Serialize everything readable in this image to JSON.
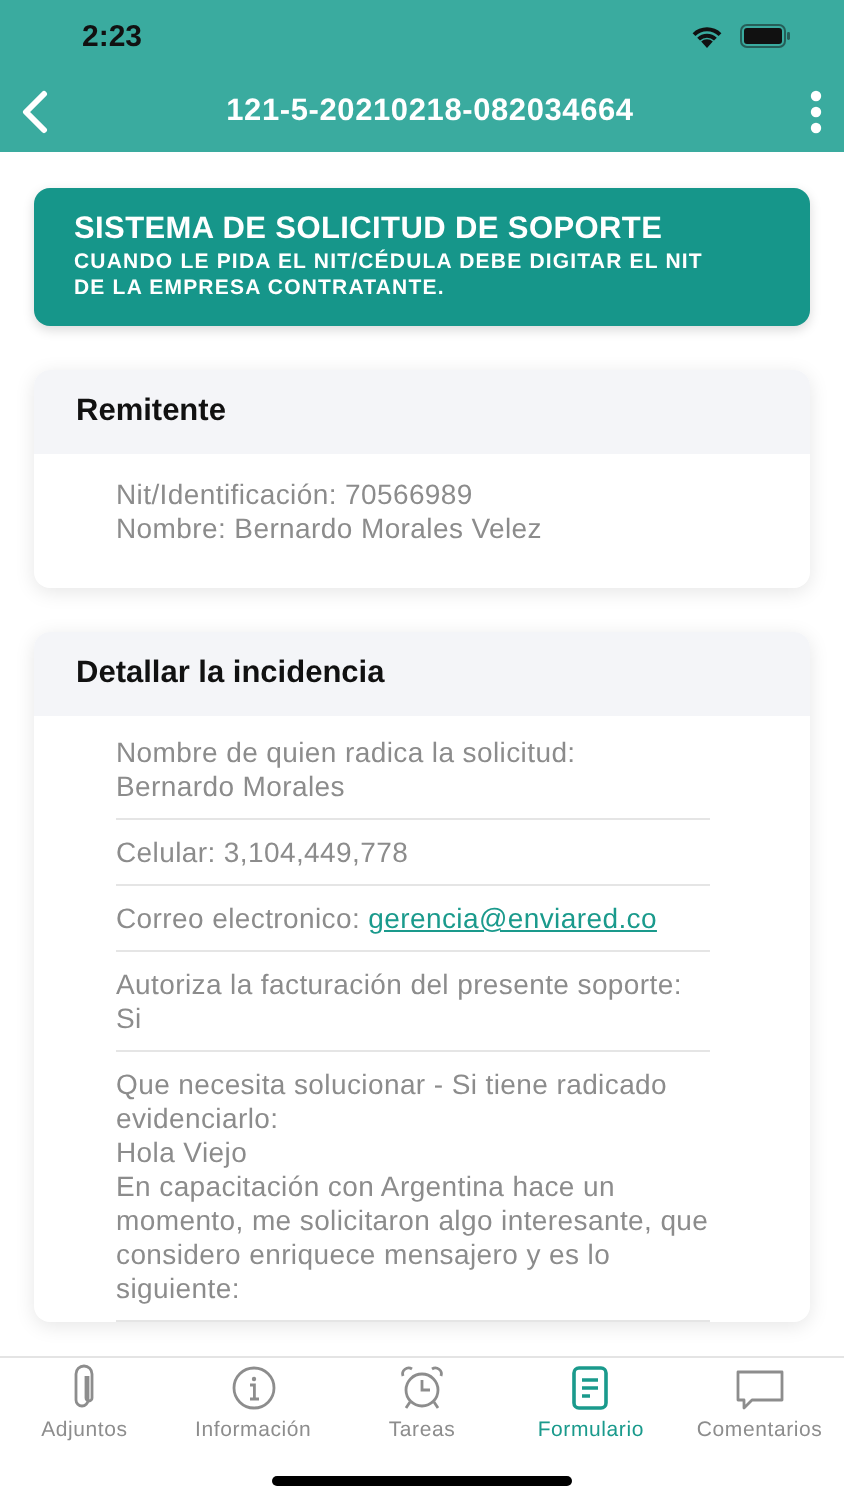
{
  "status_bar": {
    "time": "2:23"
  },
  "header": {
    "title": "121-5-20210218-082034664"
  },
  "banner": {
    "title": "SISTEMA DE SOLICITUD DE SOPORTE",
    "subtitle": "CUANDO LE PIDA EL NIT/CÉDULA DEBE DIGITAR EL NIT DE LA EMPRESA CONTRATANTE."
  },
  "sections": [
    {
      "title": "Remitente",
      "fields": [
        {
          "lines": [
            "Nit/Identificación: 70566989",
            "Nombre: Bernardo Morales Velez"
          ]
        }
      ]
    },
    {
      "title": "Detallar la incidencia",
      "fields": [
        {
          "lines": [
            "Nombre de quien radica la solicitud:",
            "Bernardo Morales"
          ]
        },
        {
          "lines": [
            "Celular: 3,104,449,778"
          ]
        },
        {
          "lines": [
            "Correo electronico:"
          ],
          "link": "gerencia@enviared.co"
        },
        {
          "lines": [
            "Autoriza la facturación del presente soporte: Si"
          ]
        },
        {
          "lines": [
            "Que necesita solucionar - Si tiene radicado evidenciarlo:",
            "Hola Viejo",
            "En capacitación con Argentina hace un momento, me solicitaron algo interesante, que considero enriquece mensajero y es lo siguiente:"
          ]
        }
      ]
    }
  ],
  "tabs": [
    {
      "kind": "clip",
      "label": "Adjuntos",
      "selected": false
    },
    {
      "kind": "info",
      "label": "Información",
      "selected": false
    },
    {
      "kind": "alarm",
      "label": "Tareas",
      "selected": false
    },
    {
      "kind": "form",
      "label": "Formulario",
      "selected": true
    },
    {
      "kind": "chat",
      "label": "Comentarios",
      "selected": false
    }
  ]
}
